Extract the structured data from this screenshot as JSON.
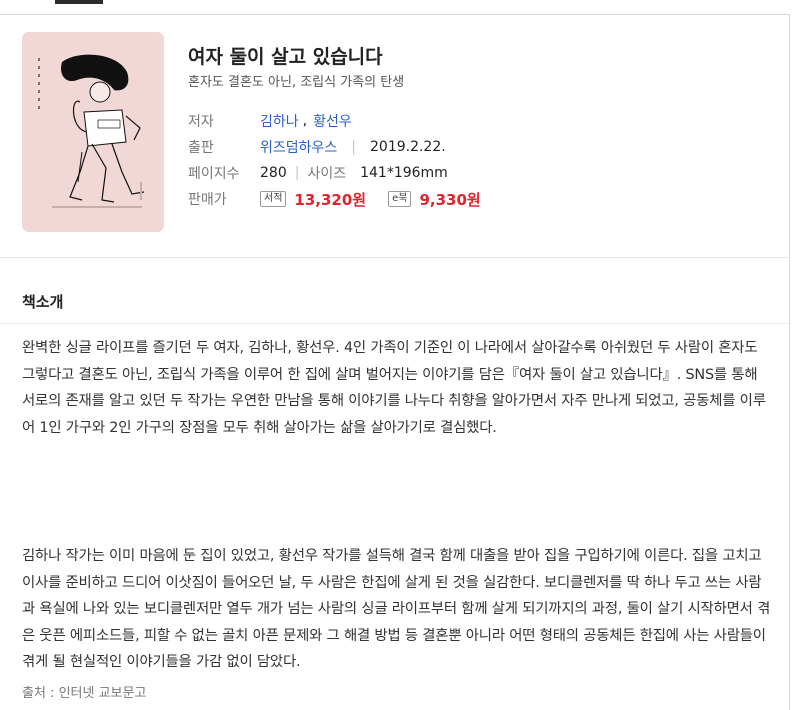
{
  "book": {
    "title": "여자 둘이 살고 있습니다",
    "subtitle": "혼자도 결혼도 아닌, 조립식 가족의 탄생",
    "authors_label": "저자",
    "authors": [
      "김하나",
      "황선우"
    ],
    "author_separator": ",",
    "publisher_label": "출판",
    "publisher": "위즈덤하우스",
    "publish_date": "2019.2.22.",
    "pages_label": "페이지수",
    "pages": "280",
    "size_label": "사이즈",
    "size": "141*196mm",
    "price_label": "판매가",
    "price_print_tag": "서적",
    "price_print": "13,320원",
    "price_ebook_tag": "e북",
    "price_ebook": "9,330원",
    "colors": {
      "link": "#2a5fc9",
      "price": "#e0232c",
      "cover": "#f1d7d5"
    }
  },
  "intro": {
    "heading": "책소개",
    "paragraph1": "완벽한 싱글 라이프를 즐기던 두 여자, 김하나, 황선우. 4인 가족이 기준인 이 나라에서 살아갈수록 아쉬웠던 두 사람이 혼자도 그렇다고 결혼도 아닌, 조립식 가족을 이루어 한 집에 살며 벌어지는 이야기를 담은『여자 둘이 살고 있습니다』. SNS를 통해 서로의 존재를 알고 있던 두 작가는 우연한 만남을 통해 이야기를 나누다 취향을 알아가면서 자주 만나게 되었고, 공동체를 이루어 1인 가구와 2인 가구의 장점을 모두 취해 살아가는 삶을 살아가기로 결심했다.",
    "paragraph2": "김하나 작가는 이미 마음에 둔 집이 있었고, 황선우 작가를 설득해 결국 함께 대출을 받아 집을 구입하기에 이른다. 집을 고치고 이사를 준비하고 드디어 이삿짐이 들어오던 날, 두 사람은 한집에 살게 된 것을 실감한다. 보디클렌저를 딱 하나 두고 쓰는 사람과 욕실에 나와 있는 보디클렌저만 열두 개가 넘는 사람의 싱글 라이프부터 함께 살게 되기까지의 과정, 둘이 살기 시작하면서 겪은 웃픈 에피소드들, 피할 수 없는 골치 아픈 문제와 그 해결 방법 등 결혼뿐 아니라 어떤 형태의 공동체든 한집에 사는 사람들이 겪게 될 현실적인 이야기들을 가감 없이 담았다.",
    "source": "출처 : 인터넷 교보문고"
  }
}
